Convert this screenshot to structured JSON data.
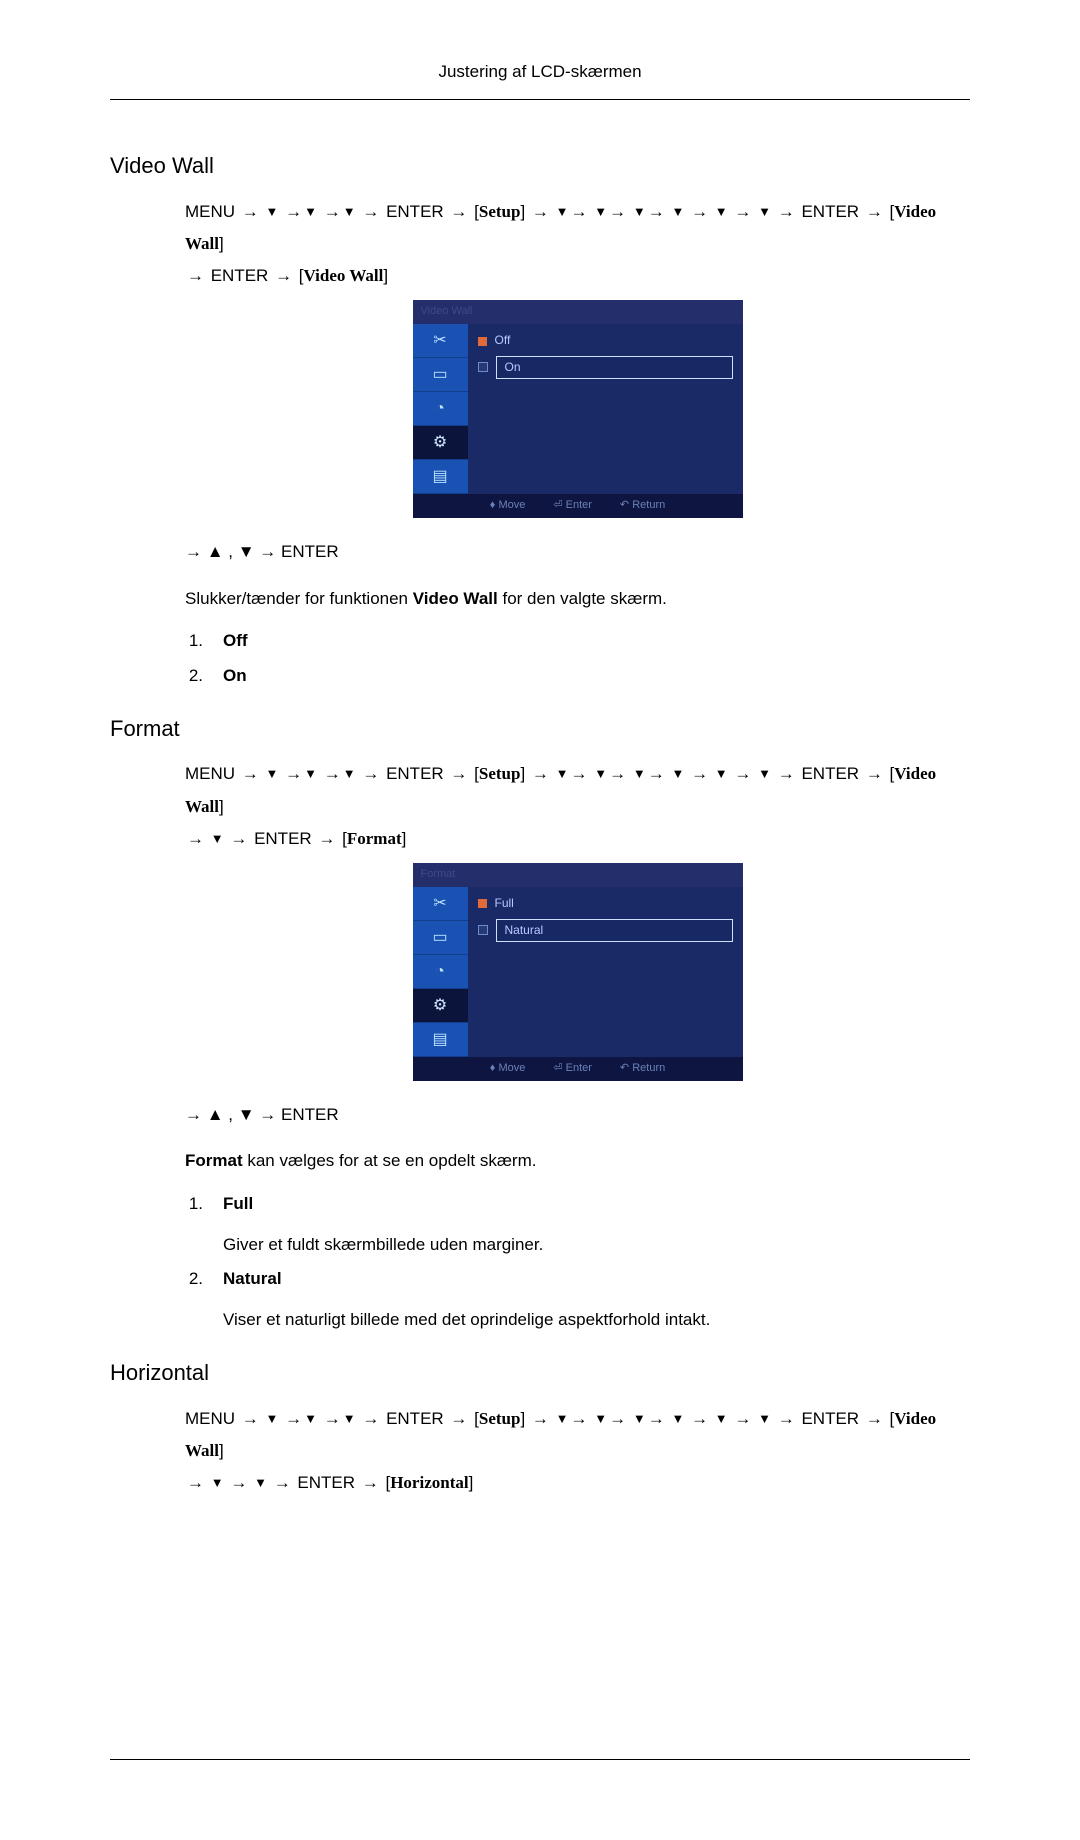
{
  "header": {
    "title": "Justering af LCD-skærmen"
  },
  "sections": {
    "videoWall": {
      "heading": "Video Wall",
      "navPath": "MENU → ▼ →▼ →▼ → ENTER → [Setup] → ▼→ ▼→ ▼→ ▼ → ▼ → ▼ → ENTER → [Video Wall] → ENTER → [Video Wall]",
      "boxSetup": "Setup",
      "boxVideoWall1": "Video Wall",
      "boxVideoWall2": "Video Wall",
      "osd": {
        "title": "Video Wall",
        "opt1": "Off",
        "opt2": "On",
        "footMove": "Move",
        "footEnter": "Enter",
        "footReturn": "Return"
      },
      "postNav": "→ ▲ , ▼ → ENTER",
      "desc_pre": "Slukker/tænder for funktionen ",
      "desc_bold": "Video Wall",
      "desc_post": " for den valgte skærm.",
      "list": {
        "i1": {
          "num": "1.",
          "title": "Off"
        },
        "i2": {
          "num": "2.",
          "title": "On"
        }
      }
    },
    "format": {
      "heading": "Format",
      "navPath": "MENU → ▼ →▼ →▼ → ENTER → [Setup] → ▼→ ▼→ ▼→ ▼ → ▼ → ▼ → ENTER → [Video Wall] → ▼ → ENTER → [Format]",
      "boxSetup": "Setup",
      "boxVideoWall": "Video Wall",
      "boxFormat": "Format",
      "osd": {
        "title": "Format",
        "opt1": "Full",
        "opt2": "Natural",
        "footMove": "Move",
        "footEnter": "Enter",
        "footReturn": "Return"
      },
      "postNav": "→ ▲ , ▼ → ENTER",
      "desc_bold": "Format",
      "desc_post": " kan vælges for at se en opdelt skærm.",
      "list": {
        "i1": {
          "num": "1.",
          "title": "Full",
          "desc": "Giver et fuldt skærmbillede uden marginer."
        },
        "i2": {
          "num": "2.",
          "title": "Natural",
          "desc": "Viser et naturligt billede med det oprindelige aspektforhold intakt."
        }
      }
    },
    "horizontal": {
      "heading": "Horizontal",
      "navPath": "MENU → ▼ →▼ →▼ → ENTER → [Setup] → ▼→ ▼→ ▼→ ▼ → ▼ → ▼ → ENTER → [Video Wall] → ▼ → ▼ → ENTER → [Horizontal]",
      "boxSetup": "Setup",
      "boxVideoWall": "Video Wall",
      "boxHorizontal": "Horizontal"
    }
  }
}
